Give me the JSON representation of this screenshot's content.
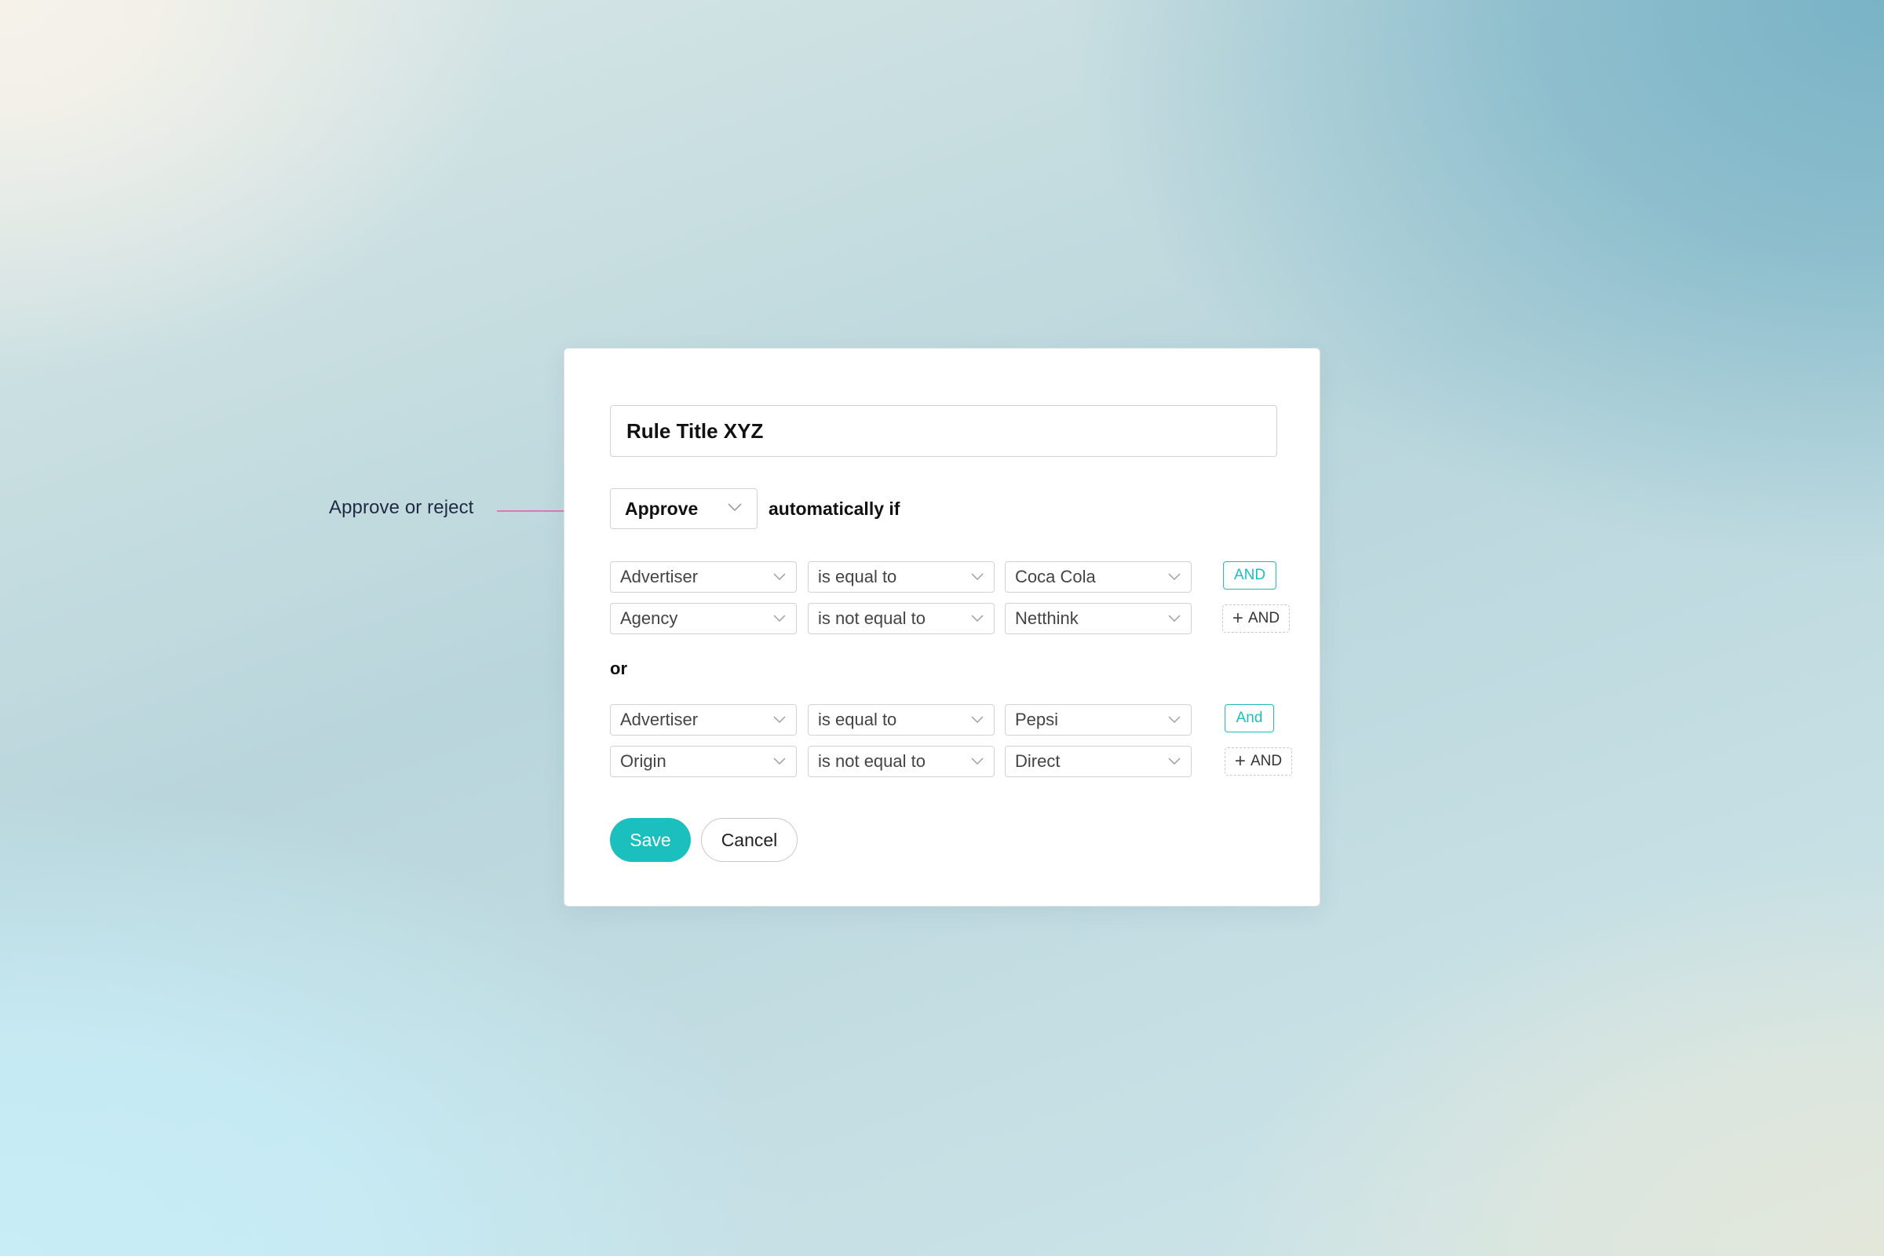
{
  "annotation": {
    "label": "Approve or reject",
    "arrow_color": "#e55aa5"
  },
  "rule": {
    "title": "Rule Title XYZ",
    "action": "Approve",
    "condition_text": "automatically if"
  },
  "groups": [
    {
      "rows": [
        {
          "field": "Advertiser",
          "operator": "is equal to",
          "value": "Coca Cola",
          "tag": "AND",
          "tag_kind": "active"
        },
        {
          "field": "Agency",
          "operator": "is not equal to",
          "value": "Netthink",
          "tag": "AND",
          "tag_kind": "add"
        }
      ]
    },
    {
      "rows": [
        {
          "field": "Advertiser",
          "operator": "is equal to",
          "value": "Pepsi",
          "tag": "And",
          "tag_kind": "active"
        },
        {
          "field": "Origin",
          "operator": "is not equal to",
          "value": "Direct",
          "tag": "AND",
          "tag_kind": "add"
        }
      ]
    }
  ],
  "or_label": "or",
  "buttons": {
    "save": "Save",
    "cancel": "Cancel"
  },
  "colors": {
    "accent": "#1bbfbe",
    "annotation_arrow": "#e55aa5"
  },
  "icons": {
    "dropdown": "chevron-down-icon",
    "add": "plus-icon",
    "annotation": "arrow-right-icon"
  }
}
